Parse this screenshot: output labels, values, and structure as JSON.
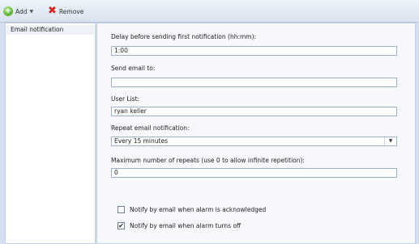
{
  "toolbar": {
    "add_label": "Add",
    "add_icon": "add-green-circle-icon",
    "remove_label": "Remove",
    "remove_icon": "red-x-icon"
  },
  "sidebar": {
    "items": [
      {
        "label": "Email notification",
        "selected": true
      }
    ]
  },
  "form": {
    "delay_label": "Delay before sending first notification (hh:mm):",
    "delay_value": "1:00",
    "send_to_label": "Send email to:",
    "send_to_value": "",
    "user_list_label": "User List:",
    "user_list_value": "ryan keller",
    "repeat_label": "Repeat email notification:",
    "repeat_value": "Every 15 minutes",
    "max_repeats_label": "Maximum number of repeats (use 0 to allow infinite repetition):",
    "max_repeats_value": "0",
    "notify_ack_label": "Notify by email when alarm is acknowledged",
    "notify_ack_checked": false,
    "notify_off_label": "Notify by email when alarm turns off",
    "notify_off_checked": true
  },
  "colors": {
    "background": "#d4dff0",
    "panel": "#f6f8fb",
    "field_border": "#9fb0c8",
    "remove_red": "#d3261d",
    "add_green": "#3a9b1c"
  }
}
